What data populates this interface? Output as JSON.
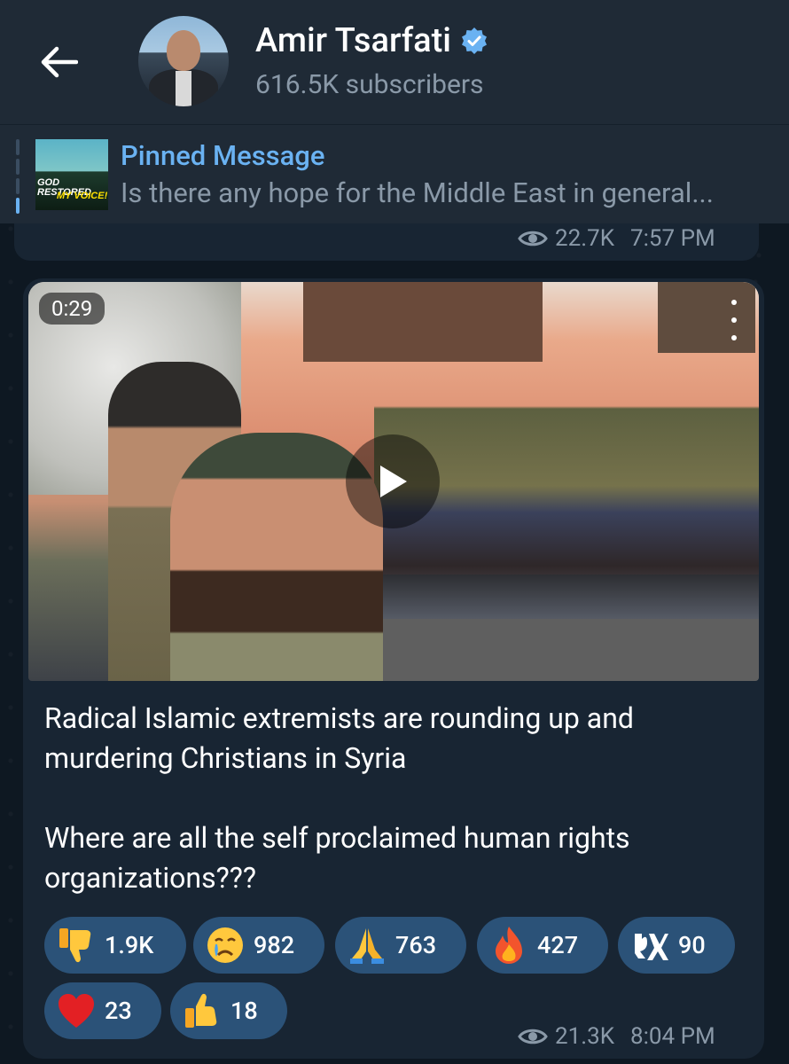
{
  "header": {
    "channel_name": "Amir Tsarfati",
    "subscribers": "616.5K subscribers"
  },
  "pinned": {
    "title": "Pinned Message",
    "preview": "Is there any hope for the Middle East in general...",
    "thumb_line1": "GOD RESTORED",
    "thumb_line2": "MY VOICE!"
  },
  "prev_message": {
    "views": "22.7K",
    "time": "7:57 PM"
  },
  "message": {
    "video_duration": "0:29",
    "paragraph1": "Radical Islamic extremists are rounding up and murdering Christians in Syria",
    "paragraph2": "Where are all the self proclaimed human rights organizations???",
    "views": "21.3K",
    "time": "8:04 PM",
    "reactions": [
      {
        "emoji": "thumbs-down",
        "count": "1.9K"
      },
      {
        "emoji": "crying-face",
        "count": "982"
      },
      {
        "emoji": "folded-hands",
        "count": "763"
      },
      {
        "emoji": "fire",
        "count": "427"
      },
      {
        "emoji": "custom-logo",
        "count": "90"
      },
      {
        "emoji": "red-heart",
        "count": "23"
      },
      {
        "emoji": "thumbs-up",
        "count": "18"
      }
    ]
  },
  "colors": {
    "header_bg": "#1f2a36",
    "bubble_bg": "#182533",
    "accent": "#6ab2f2",
    "reaction_bg": "#2b5278",
    "secondary_text": "#8a99a8"
  }
}
